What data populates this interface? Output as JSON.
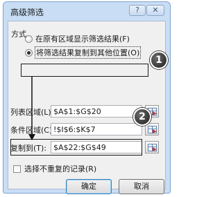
{
  "dialog": {
    "title": "高级筛选",
    "help_icon": "?",
    "close_icon": "✕"
  },
  "mode": {
    "section_label": "方式",
    "option_in_place": "在原有区域显示筛选结果(F)",
    "option_copy": "将筛选结果复制到其他位置(O)",
    "selected": "option_copy"
  },
  "fields": {
    "list_range_label": "列表区域(L):",
    "list_range_value": "$A$1:$G$20",
    "criteria_range_label": "条件区域(C):",
    "criteria_range_value": "!$I$6:$K$7",
    "copy_to_label": "复制到(T):",
    "copy_to_value": "$A$22:$G$49"
  },
  "unique_records": {
    "label": "选择不重复的记录(R)",
    "checked": false
  },
  "buttons": {
    "ok": "确定",
    "cancel": "取消"
  },
  "callouts": {
    "first": "1",
    "second": "2"
  }
}
